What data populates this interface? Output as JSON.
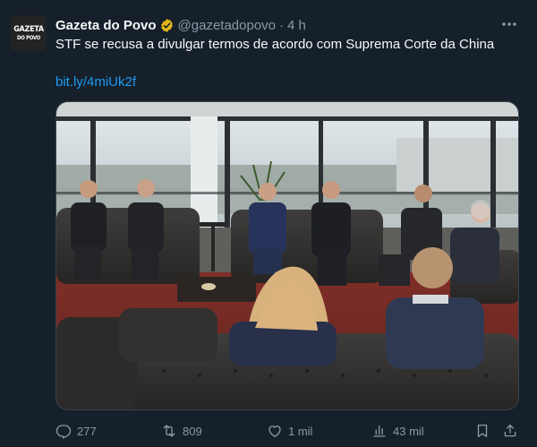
{
  "author": {
    "avatar_line1": "GAZETA",
    "avatar_line2": "DO POVO",
    "name": "Gazeta do Povo",
    "handle": "@gazetadopovo",
    "separator": "·",
    "time": "4 h"
  },
  "tweet": {
    "text": "STF se recusa a divulgar termos de acordo com Suprema Corte da China",
    "link": "bit.ly/4miUk2f"
  },
  "metrics": {
    "replies": "277",
    "retweets": "809",
    "likes": "1 mil",
    "views": "43 mil"
  },
  "icons": {
    "verified": "verified-gold-badge-icon",
    "more": "more-options-icon",
    "reply": "reply-icon",
    "retweet": "retweet-icon",
    "like": "heart-icon",
    "views": "views-chart-icon",
    "bookmark": "bookmark-icon",
    "share": "share-icon"
  },
  "colors": {
    "background": "#15202b",
    "text": "#f7f9f9",
    "secondary": "#8b98a5",
    "link": "#1d9bf0",
    "verified_badge": "#e2b719"
  }
}
